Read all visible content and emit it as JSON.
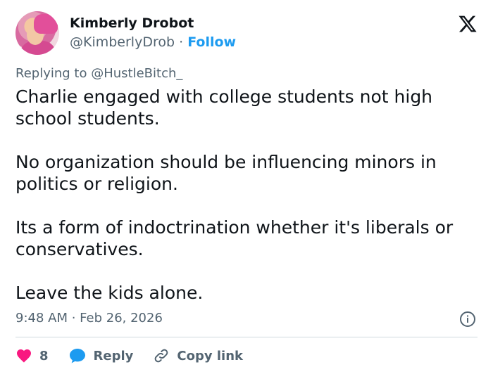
{
  "author": {
    "name": "Kimberly Drobot",
    "handle": "@KimberlyDrob",
    "separator": "·",
    "follow_label": "Follow"
  },
  "reply": {
    "prefix": "Replying to",
    "mention": "@HustleBitch_"
  },
  "post": {
    "paragraphs": [
      "Charlie engaged with college students not high school students.",
      "No organization should be influencing minors in politics or religion.",
      "Its a form of indoctrination whether it's liberals or conservatives.",
      "Leave the kids alone."
    ],
    "timestamp": "9:48 AM · Feb 26, 2026"
  },
  "actions": {
    "likes_count": "8",
    "reply_label": "Reply",
    "copy_link_label": "Copy link"
  },
  "icons": {
    "x_logo": "x-logo-icon",
    "info": "info-icon",
    "heart": "heart-icon",
    "reply": "reply-bubble-icon",
    "link": "link-icon"
  },
  "colors": {
    "accent": "#1d9bf0",
    "like": "#f91880",
    "muted": "#536471",
    "text": "#0f1419"
  }
}
